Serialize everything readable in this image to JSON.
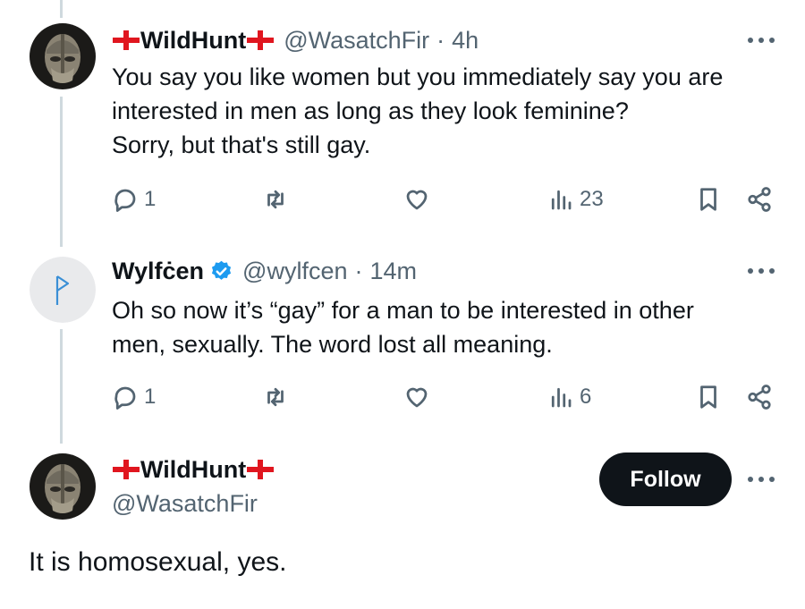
{
  "colors": {
    "text": "#0f1419",
    "secondary": "#536471",
    "flag_red": "#e0161f",
    "verified_blue": "#1d9bf0",
    "thread_line": "#cfd9de",
    "follow_bg": "#0f1419"
  },
  "tweets": [
    {
      "author_name": "WildHunt",
      "name_decoration": "england-flag-icon",
      "handle": "@WasatchFir",
      "separator": "·",
      "time": "4h",
      "text_lines": [
        "You say you like women but you immediately say you are",
        "interested in men as long as they look feminine?",
        "Sorry, but that's still gay."
      ],
      "reply_count": "1",
      "view_count": "23"
    },
    {
      "author_name": "Wylfċen",
      "verified": true,
      "handle": "@wylfcen",
      "separator": "·",
      "time": "14m",
      "text_lines": [
        "Oh so now it’s “gay” for a man to be interested in other",
        "men, sexually. The word lost all meaning."
      ],
      "reply_count": "1",
      "view_count": "6"
    }
  ],
  "main_tweet": {
    "author_name": "WildHunt",
    "name_decoration": "england-flag-icon",
    "handle": "@WasatchFir",
    "follow_label": "Follow",
    "text": "It is homosexual, yes."
  },
  "icons": [
    "reply-icon",
    "retweet-icon",
    "like-icon",
    "views-icon",
    "bookmark-icon",
    "share-icon",
    "more-icon",
    "verified-badge-icon"
  ]
}
